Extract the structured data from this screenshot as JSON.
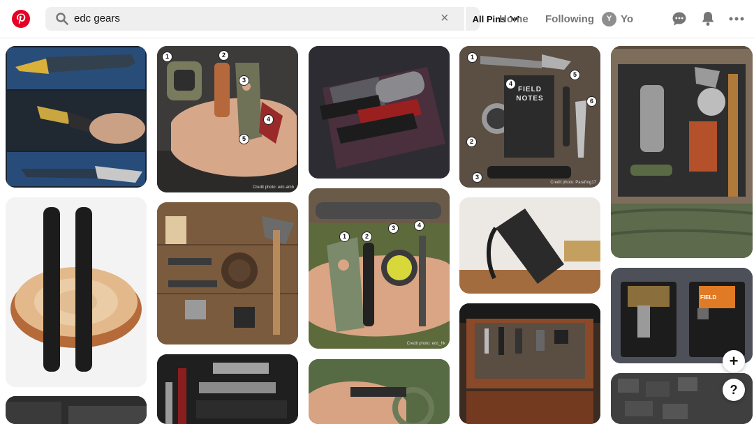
{
  "search": {
    "value": "edc gears",
    "scope_label": "All Pins"
  },
  "nav": {
    "home": "Home",
    "following": "Following",
    "avatar_initial": "Y",
    "user_name": "Yo"
  },
  "pins": [
    {
      "id": "knives-collage"
    },
    {
      "id": "hand-watch-flashlight-knife",
      "badges": [
        "1",
        "2",
        "3",
        "4",
        "5"
      ],
      "credit": "Credit photo: edc.amb"
    },
    {
      "id": "wallet-multitool-tray"
    },
    {
      "id": "field-notes-flatlay",
      "badges": [
        "1",
        "2",
        "3",
        "4",
        "5",
        "6"
      ],
      "card_title": "FIELD NOTES",
      "credit": "Credit photo: Parafrog17"
    },
    {
      "id": "outdoor-canvas-kit"
    },
    {
      "id": "ferro-rods-wood"
    },
    {
      "id": "bushcraft-axe-flatlay"
    },
    {
      "id": "hand-knife-watch-pen",
      "badges": [
        "1",
        "2",
        "3",
        "4"
      ],
      "credit": "Credit photo: edc_hk"
    },
    {
      "id": "multitool-closeup"
    },
    {
      "id": "field-pouch-organizer",
      "card_title": "FIELD"
    },
    {
      "id": "wooden-drawer-knives"
    },
    {
      "id": "multi-tool-card"
    },
    {
      "id": "keychain-tools-dark"
    },
    {
      "id": "hand-paracord-knife"
    },
    {
      "id": "stone-pavement"
    }
  ],
  "floating": {
    "add": "+",
    "help": "?"
  }
}
